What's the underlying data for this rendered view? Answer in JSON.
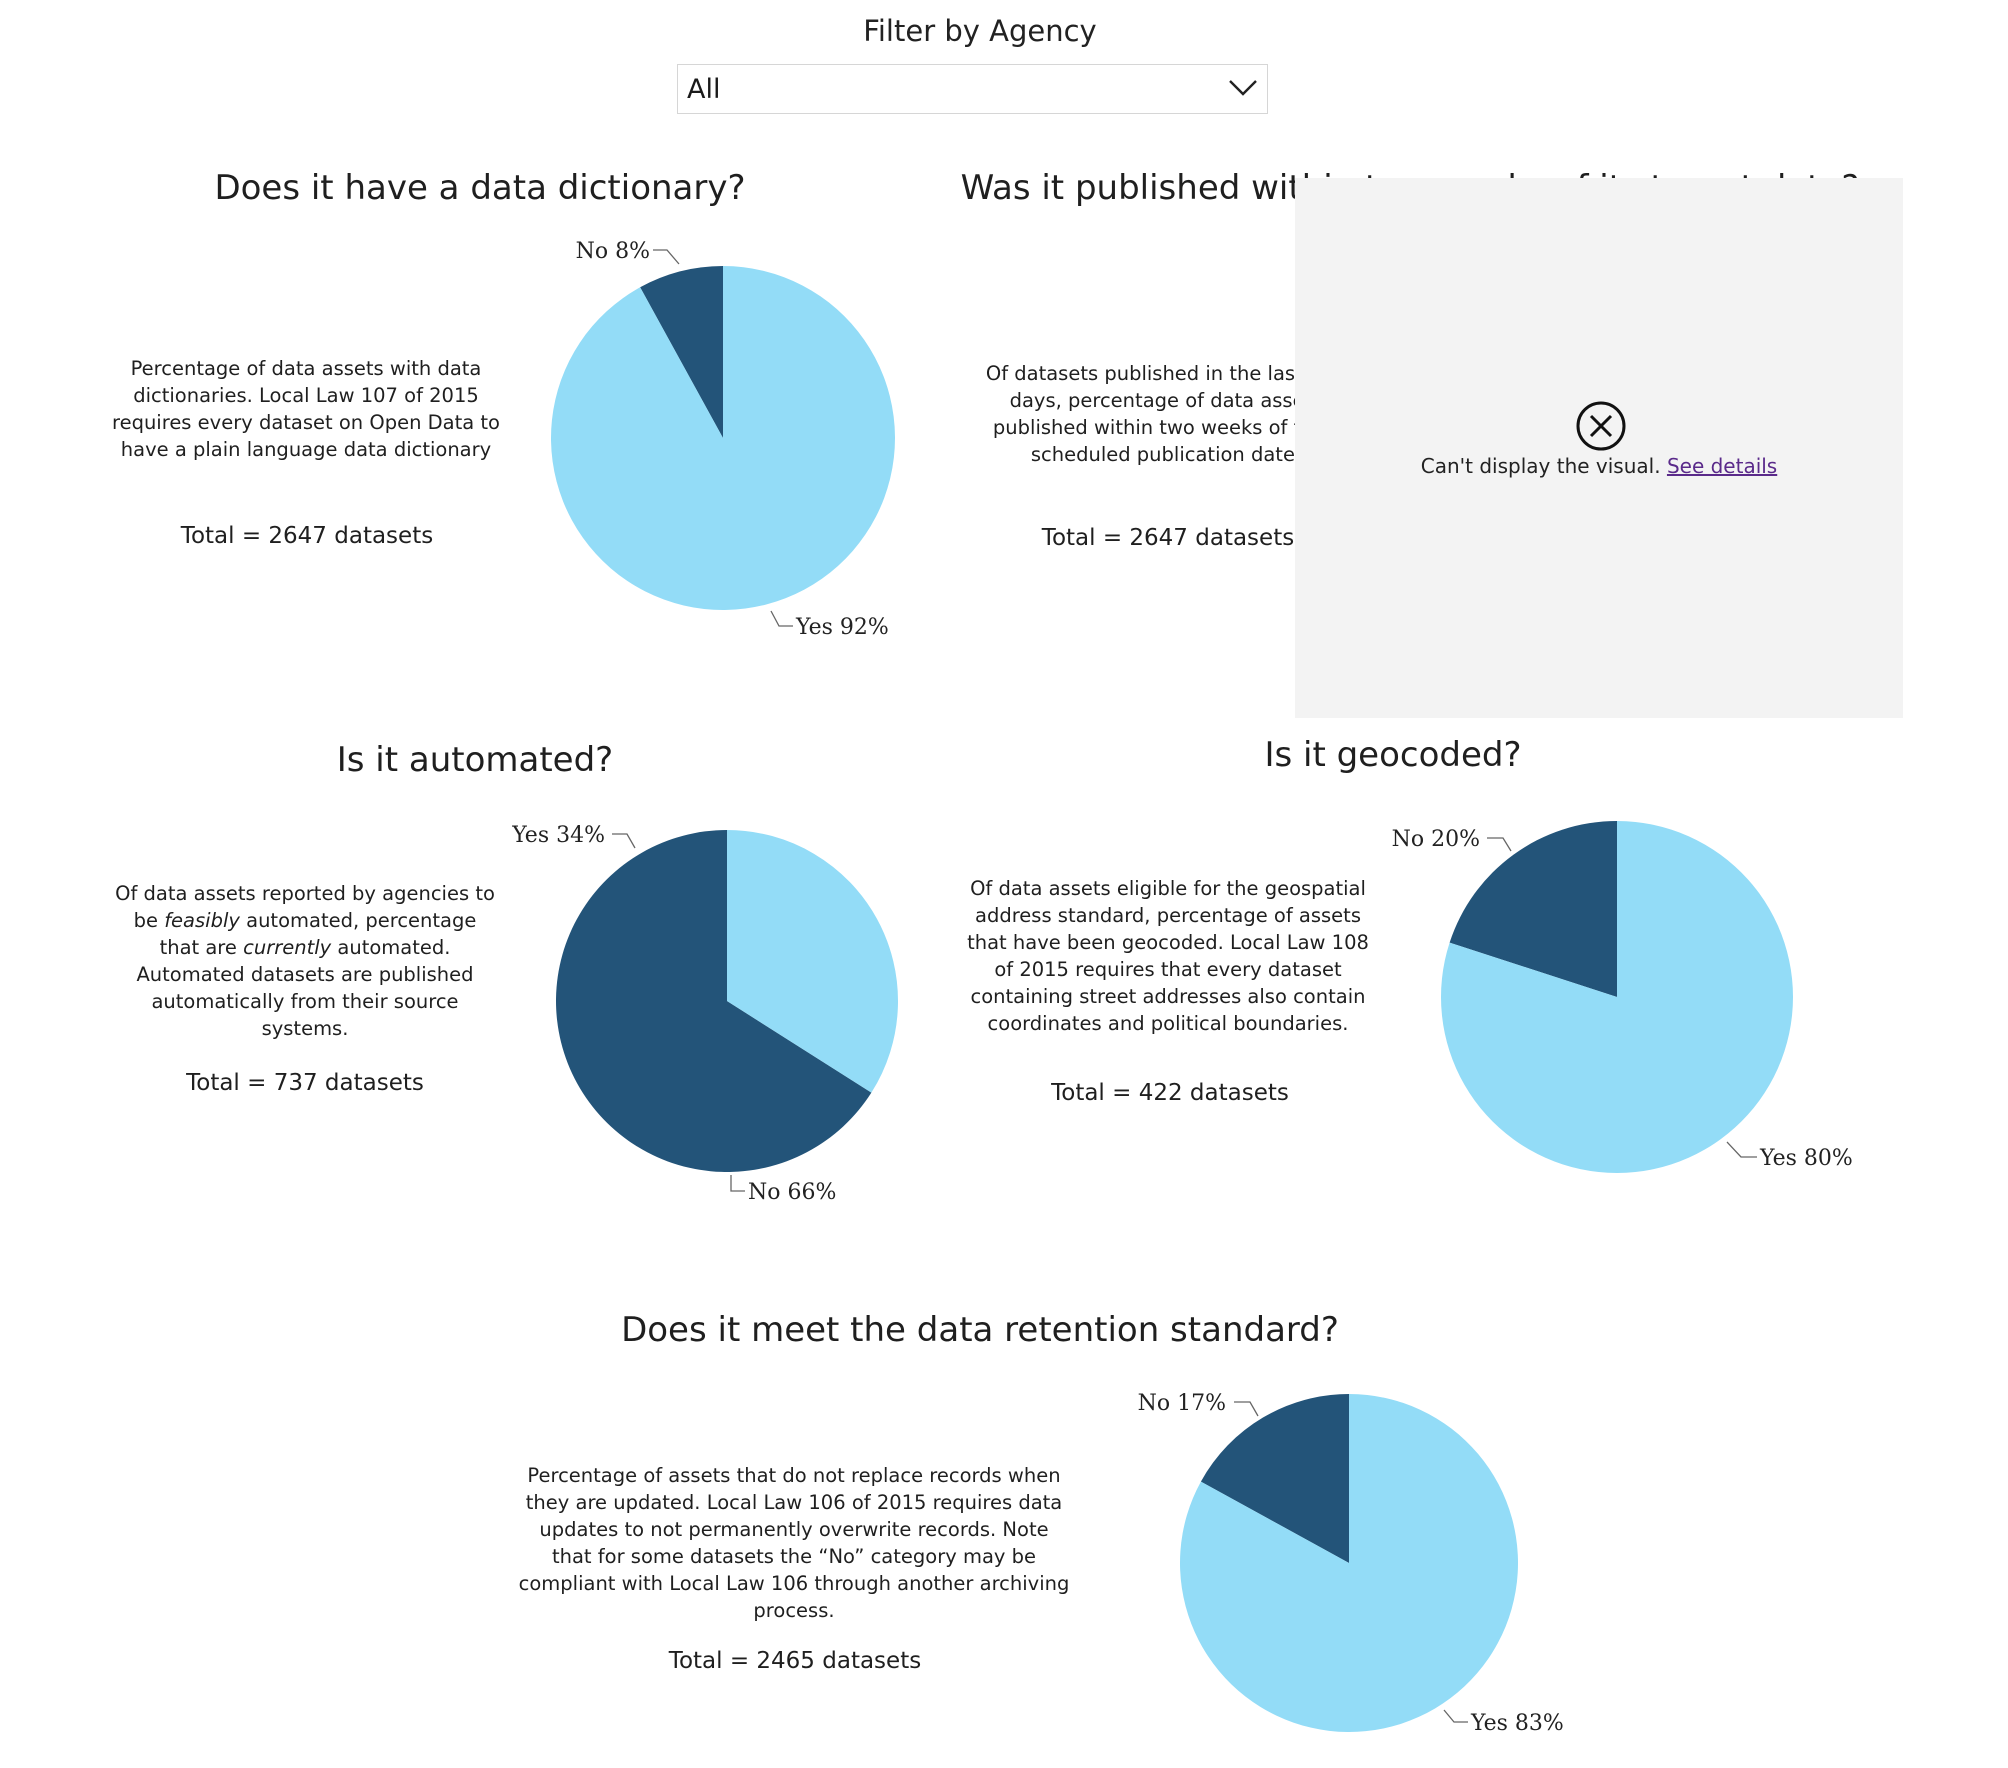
{
  "filter": {
    "label": "Filter by Agency",
    "selected": "All"
  },
  "colors": {
    "yes": "#93dcf7",
    "no": "#235479",
    "error_bg": "#f3f3f3",
    "link": "#5a2a8a"
  },
  "panels": {
    "dictionary": {
      "title": "Does it have a data dictionary?",
      "description": "Percentage of data assets with data dictionaries. Local Law 107 of 2015 requires every dataset on Open Data to have a plain language data dictionary",
      "total": "Total = 2647 datasets"
    },
    "published": {
      "title": "Was it published within two weeks of its target date?",
      "description": "Of datasets published in the last 365 days, percentage of data assets published within two weeks of their scheduled publication date.",
      "total": "Total = 2647 datasets",
      "error": {
        "message": "Can't display the visual.",
        "link": "See details",
        "icon": "close-circle-icon"
      }
    },
    "automated": {
      "title": "Is it automated?",
      "description_parts": [
        "Of data assets reported by agencies to be ",
        "feasibly",
        " automated, percentage that are ",
        "currently",
        " automated. Automated datasets are published automatically from their source systems."
      ],
      "total": "Total =  737 datasets"
    },
    "geocoded": {
      "title": "Is it geocoded?",
      "description": "Of data assets eligible for the geospatial address standard, percentage of assets that have been geocoded. Local Law 108 of 2015 requires that every dataset containing street addresses also contain coordinates and political boundaries.",
      "total": "Total = 422 datasets"
    },
    "retention": {
      "title": "Does it meet the data retention standard?",
      "description": "Percentage of assets that do not replace records when they are updated. Local Law 106 of 2015 requires data updates to not permanently overwrite records. Note that for some datasets the “No” category may be compliant with Local Law 106 through another archiving process.",
      "total": "Total =  2465 datasets"
    }
  },
  "chart_data": [
    {
      "id": "dictionary",
      "type": "pie",
      "title": "Does it have a data dictionary?",
      "slices": [
        {
          "label": "No",
          "value": 8,
          "display": "No 8%"
        },
        {
          "label": "Yes",
          "value": 92,
          "display": "Yes 92%"
        }
      ]
    },
    {
      "id": "automated",
      "type": "pie",
      "title": "Is it automated?",
      "slices": [
        {
          "label": "No",
          "value": 66,
          "display": "No 66%"
        },
        {
          "label": "Yes",
          "value": 34,
          "display": "Yes 34%"
        }
      ]
    },
    {
      "id": "geocoded",
      "type": "pie",
      "title": "Is it geocoded?",
      "slices": [
        {
          "label": "No",
          "value": 20,
          "display": "No 20%"
        },
        {
          "label": "Yes",
          "value": 80,
          "display": "Yes 80%"
        }
      ]
    },
    {
      "id": "retention",
      "type": "pie",
      "title": "Does it meet the data retention standard?",
      "slices": [
        {
          "label": "No",
          "value": 17,
          "display": "No 17%"
        },
        {
          "label": "Yes",
          "value": 83,
          "display": "Yes 83%"
        }
      ]
    }
  ]
}
